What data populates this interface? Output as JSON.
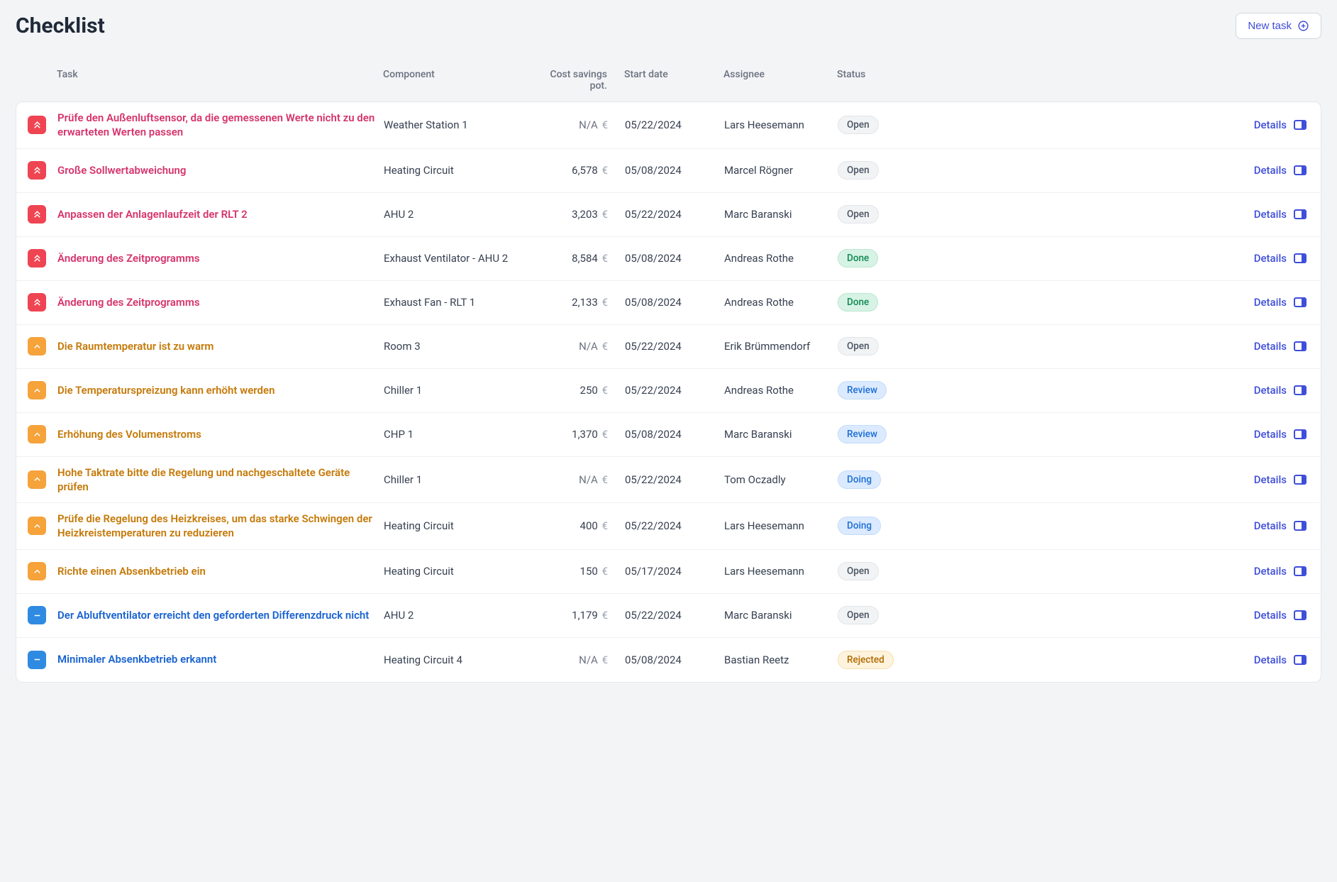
{
  "header": {
    "title": "Checklist",
    "new_task_label": "New task"
  },
  "columns": {
    "task": "Task",
    "component": "Component",
    "cost": "Cost savings pot.",
    "start": "Start date",
    "assignee": "Assignee",
    "status": "Status"
  },
  "labels": {
    "details": "Details",
    "currency": "€",
    "na": "N/A"
  },
  "status_labels": {
    "open": "Open",
    "done": "Done",
    "review": "Review",
    "doing": "Doing",
    "rejected": "Rejected"
  },
  "tasks": [
    {
      "priority": "high",
      "name": "Prüfe den Außenluftsensor, da die gemessenen Werte nicht zu den erwarteten Werten passen",
      "component": "Weather Station 1",
      "cost": null,
      "start": "05/22/2024",
      "assignee": "Lars Heesemann",
      "status": "open"
    },
    {
      "priority": "high",
      "name": "Große Sollwertabweichung",
      "component": "Heating Circuit",
      "cost": "6,578",
      "start": "05/08/2024",
      "assignee": "Marcel Rögner",
      "status": "open"
    },
    {
      "priority": "high",
      "name": "Anpassen der Anlagenlaufzeit der RLT 2",
      "component": "AHU 2",
      "cost": "3,203",
      "start": "05/22/2024",
      "assignee": "Marc Baranski",
      "status": "open"
    },
    {
      "priority": "high",
      "name": "Änderung des Zeitprogramms",
      "component": "Exhaust Ventilator - AHU 2",
      "cost": "8,584",
      "start": "05/08/2024",
      "assignee": "Andreas Rothe",
      "status": "done"
    },
    {
      "priority": "high",
      "name": "Änderung des Zeitprogramms",
      "component": "Exhaust Fan - RLT 1",
      "cost": "2,133",
      "start": "05/08/2024",
      "assignee": "Andreas Rothe",
      "status": "done"
    },
    {
      "priority": "med",
      "name": "Die Raumtemperatur ist zu warm",
      "component": "Room 3",
      "cost": null,
      "start": "05/22/2024",
      "assignee": "Erik Brümmendorf",
      "status": "open"
    },
    {
      "priority": "med",
      "name": "Die Temperaturspreizung kann erhöht werden",
      "component": "Chiller 1",
      "cost": "250",
      "start": "05/22/2024",
      "assignee": "Andreas Rothe",
      "status": "review"
    },
    {
      "priority": "med",
      "name": "Erhöhung des Volumenstroms",
      "component": "CHP 1",
      "cost": "1,370",
      "start": "05/08/2024",
      "assignee": "Marc Baranski",
      "status": "review"
    },
    {
      "priority": "med",
      "name": "Hohe Taktrate bitte die Regelung und nachgeschaltete Geräte prüfen",
      "component": "Chiller 1",
      "cost": null,
      "start": "05/22/2024",
      "assignee": "Tom Oczadly",
      "status": "doing"
    },
    {
      "priority": "med",
      "name": "Prüfe die Regelung des Heizkreises, um das starke Schwingen der Heizkreistemperaturen zu reduzieren",
      "component": "Heating Circuit",
      "cost": "400",
      "start": "05/22/2024",
      "assignee": "Lars Heesemann",
      "status": "doing"
    },
    {
      "priority": "med",
      "name": "Richte einen Absenkbetrieb ein",
      "component": "Heating Circuit",
      "cost": "150",
      "start": "05/17/2024",
      "assignee": "Lars Heesemann",
      "status": "open"
    },
    {
      "priority": "low",
      "name": "Der Abluftventilator erreicht den geforderten Differenzdruck nicht",
      "component": "AHU 2",
      "cost": "1,179",
      "start": "05/22/2024",
      "assignee": "Marc Baranski",
      "status": "open"
    },
    {
      "priority": "low",
      "name": "Minimaler Absenkbetrieb erkannt",
      "component": "Heating Circuit 4",
      "cost": null,
      "start": "05/08/2024",
      "assignee": "Bastian Reetz",
      "status": "rejected"
    }
  ]
}
